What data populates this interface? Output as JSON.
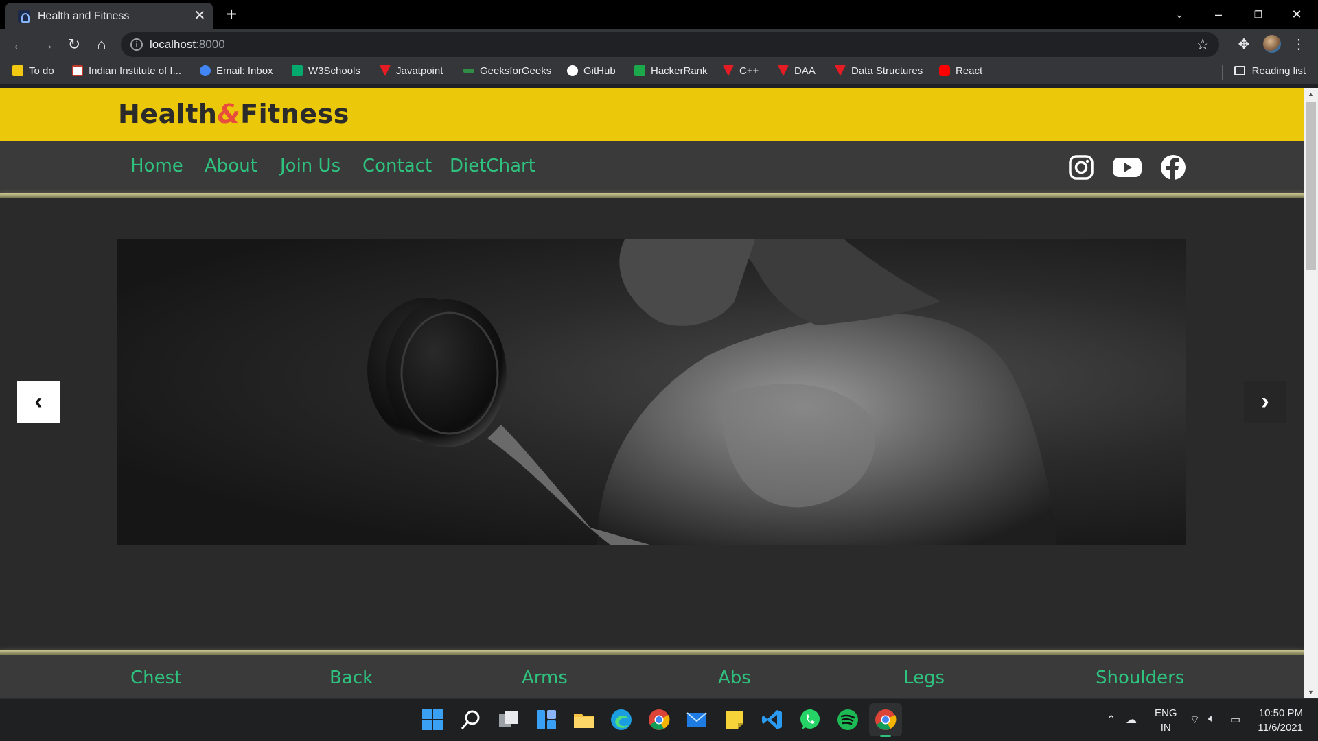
{
  "browser": {
    "tab_title": "Health and Fitness",
    "url_host": "localhost",
    "url_port": ":8000",
    "bookmarks": [
      {
        "label": "To do",
        "color": "#f2c811"
      },
      {
        "label": "Indian Institute of I...",
        "color": "#c0392b"
      },
      {
        "label": "Email: Inbox",
        "color": "#4285f4"
      },
      {
        "label": "W3Schools",
        "color": "#04aa6d"
      },
      {
        "label": "Javatpoint",
        "color": "#e51c23"
      },
      {
        "label": "GeeksforGeeks",
        "color": "#2f8d46"
      },
      {
        "label": "GitHub",
        "color": "#ffffff"
      },
      {
        "label": "HackerRank",
        "color": "#1ba94c"
      },
      {
        "label": "C++",
        "color": "#e51c23"
      },
      {
        "label": "DAA",
        "color": "#e51c23"
      },
      {
        "label": "Data Structures",
        "color": "#e51c23"
      },
      {
        "label": "React",
        "color": "#ff0000"
      }
    ],
    "reading_list": "Reading list"
  },
  "site": {
    "brand_left": "Health",
    "brand_amp": "&",
    "brand_right": "Fitness",
    "nav": [
      "Home",
      "About",
      "Join Us",
      "Contact",
      "DietChart"
    ],
    "social_icons": [
      "instagram-icon",
      "youtube-icon",
      "facebook-icon"
    ],
    "categories": [
      "Chest",
      "Back",
      "Arms",
      "Abs",
      "Legs",
      "Shoulders"
    ],
    "brand_color": "#ecc80b",
    "link_color": "#2ec27e",
    "accent_color": "#e74c3c"
  },
  "taskbar": {
    "lang_line1": "ENG",
    "lang_line2": "IN",
    "time": "10:50 PM",
    "date": "11/6/2021"
  }
}
